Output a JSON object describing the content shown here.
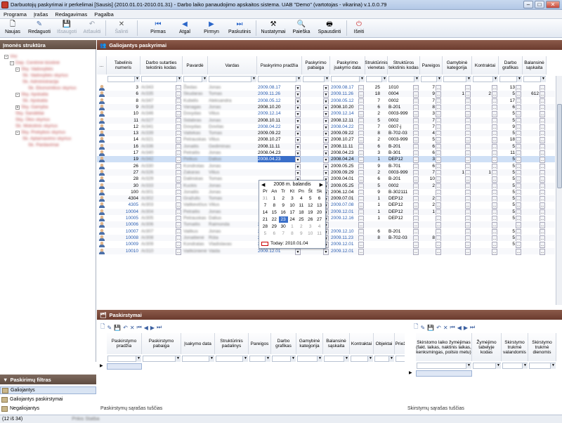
{
  "window": {
    "title": "Darbuotojų paskyrimai ir perkelimai [Sausis] (2010.01.01-2010.01.31) - Darbo laiko panaudojimo apskaitos sistema. UAB \"Demo\" (vartotojas - vikarina) v.1.0.0.79"
  },
  "menu": [
    "Programa",
    "Įrašas",
    "Redagavimas",
    "Pagalba"
  ],
  "toolbar": [
    {
      "label": "Naujas",
      "icon": "new-doc-icon",
      "enabled": true
    },
    {
      "label": "Redaguoti",
      "icon": "edit-icon",
      "enabled": true
    },
    {
      "label": "Išsaugoti",
      "icon": "save-icon",
      "enabled": false
    },
    {
      "label": "Atšaukti",
      "icon": "undo-icon",
      "enabled": false
    },
    {
      "label": "Šalinti",
      "icon": "delete-icon",
      "enabled": false
    },
    {
      "label": "Pirmas",
      "icon": "first-icon",
      "enabled": true
    },
    {
      "label": "Atgal",
      "icon": "prev-icon",
      "enabled": true
    },
    {
      "label": "Pirmyn",
      "icon": "next-icon",
      "enabled": true
    },
    {
      "label": "Paskutinis",
      "icon": "last-icon",
      "enabled": true
    },
    {
      "label": "Nustatymai",
      "icon": "settings-icon",
      "enabled": true
    },
    {
      "label": "Paieška",
      "icon": "search-icon",
      "enabled": true
    },
    {
      "label": "Spausdinti",
      "icon": "print-icon",
      "enabled": true
    },
    {
      "label": "Išeiti",
      "icon": "exit-icon",
      "enabled": true
    }
  ],
  "left": {
    "structure_title": "Įmonės struktūra",
    "tree": [
      "Visi",
      "Dep. Centrinė būstinė",
      "Sky. Vadovybės",
      "Sk. Vadovybės skyrius",
      "Sk. Administracija",
      "Sk. Ekonomikos skyrius",
      "Sky. Apskaita",
      "Sk. Apskaita",
      "Sky. Gamyba",
      "Sky. Sandėliai",
      "Sky. Ūkio skyrius",
      "Sk. Mokslinis skyrius",
      "Sky. Prekybos skyrius",
      "Sk. Aptarnavimo skyrius",
      "Sk. Pardavimai"
    ],
    "filter_title": "Paskirimų filtras",
    "filters": [
      "Galiojantys",
      "Galiojantys paskirstymai",
      "Negaliojantys"
    ]
  },
  "main": {
    "title": "Galiojantys paskyrimai",
    "columns": [
      "...",
      "Tabelinis numeris",
      "Darbo sutarties tekstinis kodas",
      "Pavardė",
      "Vardas",
      "Paskyrimo pradžia",
      "Paskyrimo pabaiga",
      "Paskyrimo įsakymo data",
      "Struktūrinis vienetas",
      "Struktūros tekstinis kodas",
      "Pareigos",
      "Gamybinė kategorija",
      "Kontraktai",
      "Darbo grafikas",
      "Balansinė sąskaita"
    ],
    "rows": [
      {
        "num": "3",
        "kodas": "Ar343",
        "pav": "Žiedas",
        "vard": "Jonas",
        "start": "2009.08.17",
        "end": "",
        "ord": "2009.08.17",
        "unit": "25",
        "code": "1010",
        "par": "7",
        "kat": "",
        "kon": "",
        "graf": "13",
        "bal": ""
      },
      {
        "num": "6",
        "kodas": "Ar335",
        "pav": "Skudaras",
        "vard": "Tomas",
        "start": "2009.11.26",
        "end": "",
        "ord": "2009.11.26",
        "unit": "18",
        "code": "0004",
        "par": "9",
        "kat": "1",
        "kon": "2",
        "graf": "5",
        "bal": "612"
      },
      {
        "num": "8",
        "kodas": "Ar347",
        "pav": "Kubelis",
        "vard": "Aleksandra",
        "start": "2008.05.12",
        "end": "",
        "ord": "2008.05.12",
        "unit": "7",
        "code": "0002",
        "par": "7",
        "kat": "",
        "kon": "",
        "graf": "17",
        "bal": ""
      },
      {
        "num": "9",
        "kodas": "Ar318",
        "pav": "Vanagas",
        "vard": "Jonas",
        "start": "2008.10.20",
        "end": "",
        "ord": "2008.10.20",
        "unit": "6",
        "code": "B-201",
        "par": "8",
        "kat": "",
        "kon": "",
        "graf": "6",
        "bal": ""
      },
      {
        "num": "10",
        "kodas": "Ar346",
        "pav": "Dovydas",
        "vard": "Vilius",
        "start": "2009.12.14",
        "end": "",
        "ord": "2009.12.14",
        "unit": "2",
        "code": "0003-999",
        "par": "3",
        "kat": "",
        "kon": "",
        "graf": "5",
        "bal": ""
      },
      {
        "num": "11",
        "kodas": "Ar327",
        "pav": "Sidabras",
        "vard": "Jonas",
        "start": "2008.10.11",
        "end": "",
        "ord": "2008.12.11",
        "unit": "5",
        "code": "0002",
        "par": "7",
        "kat": "",
        "kon": "",
        "graf": "5",
        "bal": ""
      },
      {
        "num": "12",
        "kodas": "Ar341",
        "pav": "Dovydas",
        "vard": "Dovilas",
        "start": "2008.04.22",
        "end": "",
        "ord": "2008.04.22",
        "unit": "7",
        "code": "0007-j",
        "par": "7",
        "kat": "",
        "kon": "",
        "graf": "9",
        "bal": ""
      },
      {
        "num": "13",
        "kodas": "Ar339",
        "pav": "Vaitekas",
        "vard": "Tomas",
        "start": "2009.09.22",
        "end": "",
        "ord": "2009.09.22",
        "unit": "8",
        "code": "B-702-03",
        "par": "4",
        "kat": "",
        "kon": "",
        "graf": "5",
        "bal": ""
      },
      {
        "num": "14",
        "kodas": "Ar321",
        "pav": "Petrauskas",
        "vard": "Vilius",
        "start": "2008.10.27",
        "end": "",
        "ord": "2008.10.27",
        "unit": "2",
        "code": "0003-999",
        "par": "5",
        "kat": "",
        "kon": "",
        "graf": "18",
        "bal": ""
      },
      {
        "num": "16",
        "kodas": "Ar336",
        "pav": "Jonaitis",
        "vard": "Gediminas",
        "start": "2008.11.11",
        "end": "",
        "ord": "2008.11.11",
        "unit": "6",
        "code": "B-201",
        "par": "6",
        "kat": "",
        "kon": "",
        "graf": "5",
        "bal": ""
      },
      {
        "num": "17",
        "kodas": "Ar340",
        "pav": "Petraitis",
        "vard": "Jonas",
        "start": "2008.04.23",
        "end": "",
        "ord": "2008.04.23",
        "unit": "3",
        "code": "B-301",
        "par": "6",
        "kat": "",
        "kon": "",
        "graf": "11",
        "bal": ""
      },
      {
        "num": "19",
        "kodas": "Ar342",
        "pav": "Petkus",
        "vard": "Dalius",
        "start": "2008.04.23",
        "end": "",
        "ord": "2008.04.24",
        "unit": "1",
        "code": "DEP12",
        "par": "3",
        "kat": "",
        "kon": "",
        "graf": "5",
        "bal": ""
      },
      {
        "num": "26",
        "kodas": "Ar330",
        "pav": "Kondrotas",
        "vard": "Jonas",
        "start": "",
        "end": "",
        "ord": "2009.05.25",
        "unit": "9",
        "code": "B-701",
        "par": "6",
        "kat": "",
        "kon": "",
        "graf": "5",
        "bal": ""
      },
      {
        "num": "27",
        "kodas": "Ar326",
        "pav": "Zakaras",
        "vard": "Vilius",
        "start": "",
        "end": "",
        "ord": "2009.09.29",
        "unit": "2",
        "code": "0003-999",
        "par": "7",
        "kat": "1",
        "kon": "1",
        "graf": "5",
        "bal": ""
      },
      {
        "num": "28",
        "kodas": "Ar329",
        "pav": "Dalinskas",
        "vard": "Tomas",
        "start": "",
        "end": "",
        "ord": "2009.04.01",
        "unit": "6",
        "code": "B-201",
        "par": "10",
        "kat": "",
        "kon": "",
        "graf": "5",
        "bal": ""
      },
      {
        "num": "30",
        "kodas": "Ar333",
        "pav": "Kuckis",
        "vard": "Jonas",
        "start": "",
        "end": "",
        "ord": "2009.05.25",
        "unit": "5",
        "code": "0002",
        "par": "2",
        "kat": "",
        "kon": "",
        "graf": "5",
        "bal": ""
      },
      {
        "num": "100",
        "kodas": "Ar301",
        "pav": "Jonaitis",
        "vard": "Jonas",
        "start": "",
        "end": "",
        "ord": "2006.12.04",
        "unit": "9",
        "code": "B-302111",
        "par": "",
        "kat": "",
        "kon": "",
        "graf": "5",
        "bal": ""
      },
      {
        "num": "4304",
        "kodas": "Ar302",
        "pav": "Gražulis",
        "vard": "Tomas",
        "start": "",
        "end": "",
        "ord": "2009.07.01",
        "unit": "1",
        "code": "DEP12",
        "par": "2",
        "kat": "",
        "kon": "",
        "graf": "5",
        "bal": ""
      },
      {
        "num": "4305",
        "kodas": "Ar303",
        "pav": "Vaitkevičius",
        "vard": "Vilius",
        "start": "",
        "end": "",
        "ord": "2009.07.08",
        "unit": "1",
        "code": "DEP12",
        "par": "2",
        "kat": "",
        "kon": "",
        "graf": "5",
        "bal": ""
      },
      {
        "num": "10004",
        "kodas": "Ar304",
        "pav": "Petraitis",
        "vard": "Jonas",
        "start": "",
        "end": "",
        "ord": "2009.12.01",
        "unit": "1",
        "code": "DEP12",
        "par": "1",
        "kat": "",
        "kon": "",
        "graf": "5",
        "bal": ""
      },
      {
        "num": "10005",
        "kodas": "Ar305",
        "pav": "Petrauskas",
        "vard": "Dalius",
        "start": "",
        "end": "",
        "ord": "2009.12.16",
        "unit": "1",
        "code": "DEP12",
        "par": "",
        "kat": "",
        "kon": "",
        "graf": "5",
        "bal": ""
      },
      {
        "num": "10006",
        "kodas": "Ar306",
        "pav": "Tomaitis",
        "vard": "Raimonda",
        "start": "2009.12.16",
        "end": "",
        "ord": "",
        "unit": "",
        "code": "",
        "par": "",
        "kat": "",
        "kon": "",
        "graf": "",
        "bal": ""
      },
      {
        "num": "10007",
        "kodas": "Ar307",
        "pav": "Vaitkus",
        "vard": "Jonas",
        "start": "2009.12.10",
        "end": "",
        "ord": "2009.12.10",
        "unit": "6",
        "code": "B-201",
        "par": "",
        "kat": "",
        "kon": "",
        "graf": "5",
        "bal": ""
      },
      {
        "num": "10008",
        "kodas": "Ar308",
        "pav": "Jonaitienė",
        "vard": "Rūta",
        "start": "2009.12.01",
        "end": "2010.05.31",
        "ord": "2009.11.23",
        "unit": "8",
        "code": "B-702-03",
        "par": "8",
        "kat": "",
        "kon": "",
        "graf": "5",
        "bal": ""
      },
      {
        "num": "10009",
        "kodas": "Ar309",
        "pav": "Kondratas",
        "vard": "Vladislavas",
        "start": "2009.12.01",
        "end": "",
        "ord": "2009.12.01",
        "unit": "",
        "code": "",
        "par": "",
        "kat": "",
        "kon": "",
        "graf": "5",
        "bal": ""
      },
      {
        "num": "10010",
        "kodas": "Ar310",
        "pav": "Vaitkūnienė",
        "vard": "Vaida",
        "start": "2009.12.01",
        "end": "",
        "ord": "2009.12.01",
        "unit": "",
        "code": "",
        "par": "",
        "kat": "",
        "kon": "",
        "graf": "",
        "bal": ""
      }
    ],
    "calendar": {
      "month": "2008 m. balandis",
      "days": [
        "Pr",
        "An",
        "Tr",
        "Kt",
        "Pn",
        "Št",
        "Sk"
      ],
      "cells": [
        "31",
        "1",
        "2",
        "3",
        "4",
        "5",
        "6",
        "7",
        "8",
        "9",
        "10",
        "11",
        "12",
        "13",
        "14",
        "15",
        "16",
        "17",
        "18",
        "19",
        "20",
        "21",
        "22",
        "23",
        "24",
        "25",
        "26",
        "27",
        "28",
        "29",
        "30",
        "1",
        "2",
        "3",
        "4",
        "5",
        "6",
        "7",
        "8",
        "9",
        "10",
        "11"
      ],
      "selected": "23",
      "today": "Today: 2010.01.04"
    }
  },
  "bottom": {
    "title": "Paskirstymai",
    "left_columns": [
      "Paskirstymo pradžia",
      "Paskirstymo pabaiga",
      "Įsakymo data",
      "Struktūrinis padalinys",
      "Pareigos",
      "Darbo grafikas",
      "Gamybinė kategorija",
      "Balansinė sąskaita",
      "Kontraktai",
      "Objektai",
      "Priežas"
    ],
    "right_columns": [
      "Skirstomo laiko žymėjimas (fakt. laikas, naktinis laikas, kenksmingas, poilsio metu)",
      "Žymėjimo tabelyje kodas",
      "Skirstymo trukmė valandomis",
      "Skirstymo trukmė dienomis"
    ],
    "left_empty": "Paskirstymų sąrašas tuščias",
    "right_empty": "Skirstymų sąrašas tuščias"
  },
  "status": {
    "counter": "(12 iš 34)",
    "extra": "Prikis Statba"
  }
}
